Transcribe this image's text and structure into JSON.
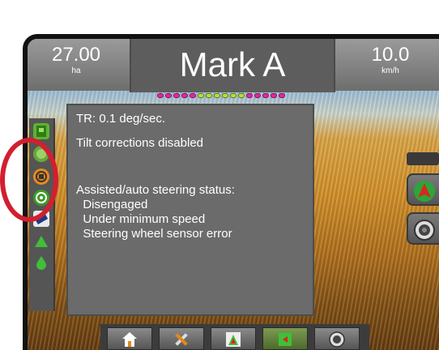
{
  "header": {
    "left_value": "27.00",
    "left_unit": "ha",
    "title": "Mark A",
    "right_value": "10.0",
    "right_unit": "km/h"
  },
  "popup": {
    "lines": [
      "TR: 0.1 deg/sec.",
      "Tilt corrections disabled",
      "Assisted/auto steering status:",
      "  Disengaged",
      "  Under minimum speed",
      "  Steering wheel sensor error"
    ]
  },
  "boom_sections": [
    "pink",
    "pink",
    "pink",
    "pink",
    "pink",
    "green",
    "green",
    "green",
    "green",
    "green",
    "green",
    "pink",
    "pink",
    "pink",
    "pink",
    "pink"
  ],
  "left_icons": [
    "tractor-icon",
    "status-green-icon",
    "steering-orange-icon",
    "steering-green-icon",
    "tilt-sensor-icon",
    "triangle-up-icon",
    "droplet-icon"
  ],
  "right_buttons": [
    "guidance-arrow-icon",
    "camera-lens-icon"
  ],
  "bottom_buttons": [
    "home-icon",
    "tools-icon",
    "guidance-view-icon",
    "mapping-icon",
    "camera-icon"
  ],
  "colors": {
    "accent_green": "#7c9a52",
    "highlight_ring": "#d21f2f"
  }
}
